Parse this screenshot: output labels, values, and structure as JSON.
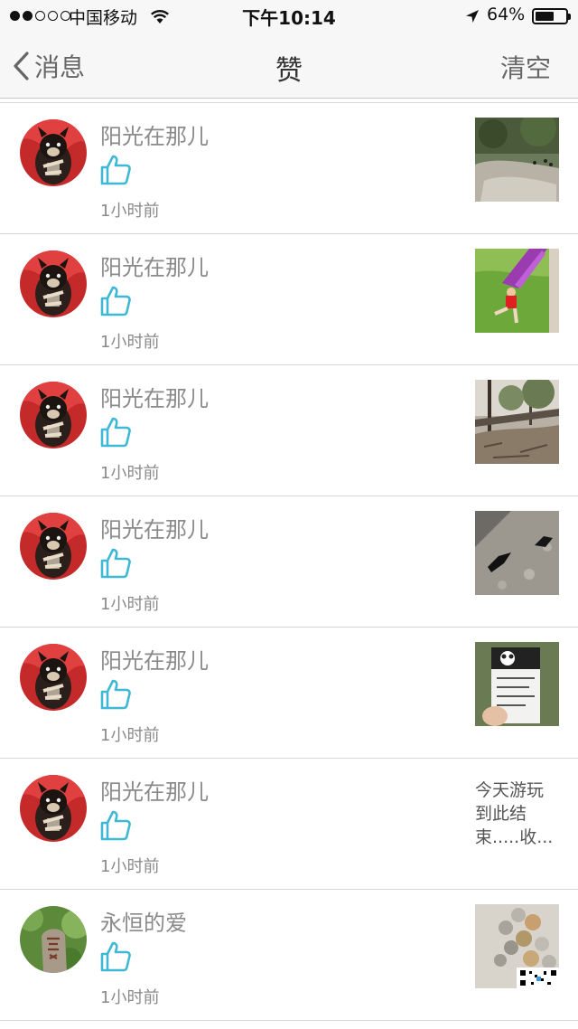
{
  "status_bar": {
    "carrier": "中国移动",
    "time": "下午10:14",
    "battery_percent": "64%",
    "battery_level": 0.64,
    "signal_bars": 2,
    "icons": [
      "signal-dots-icon",
      "wifi-icon",
      "location-arrow-icon",
      "battery-icon"
    ]
  },
  "nav": {
    "back_label": "消息",
    "title": "赞",
    "clear_label": "清空",
    "back_icon": "chevron-left-icon"
  },
  "colors": {
    "like_icon": "#3fb8d6",
    "secondary_text": "#8a8a8a",
    "nav_background": "#f7f7f7",
    "divider": "#d8d8d8"
  },
  "items": [
    {
      "username": "阳光在那儿",
      "time": "1小时前",
      "avatar": "dog-avatar",
      "thumbnail": "park-rocks-photo",
      "thumbnail_text": ""
    },
    {
      "username": "阳光在那儿",
      "time": "1小时前",
      "avatar": "dog-avatar",
      "thumbnail": "slide-photo",
      "thumbnail_text": ""
    },
    {
      "username": "阳光在那儿",
      "time": "1小时前",
      "avatar": "dog-avatar",
      "thumbnail": "trees-path-photo",
      "thumbnail_text": ""
    },
    {
      "username": "阳光在那儿",
      "time": "1小时前",
      "avatar": "dog-avatar",
      "thumbnail": "pavement-birds-photo",
      "thumbnail_text": ""
    },
    {
      "username": "阳光在那儿",
      "time": "1小时前",
      "avatar": "dog-avatar",
      "thumbnail": "panda-ticket-photo",
      "thumbnail_text": ""
    },
    {
      "username": "阳光在那儿",
      "time": "1小时前",
      "avatar": "dog-avatar",
      "thumbnail": "",
      "thumbnail_text": "今天游玩到此结束.....收..."
    },
    {
      "username": "永恒的爱",
      "time": "1小时前",
      "avatar": "stone-avatar",
      "thumbnail": "coins-photo",
      "thumbnail_text": ""
    }
  ]
}
